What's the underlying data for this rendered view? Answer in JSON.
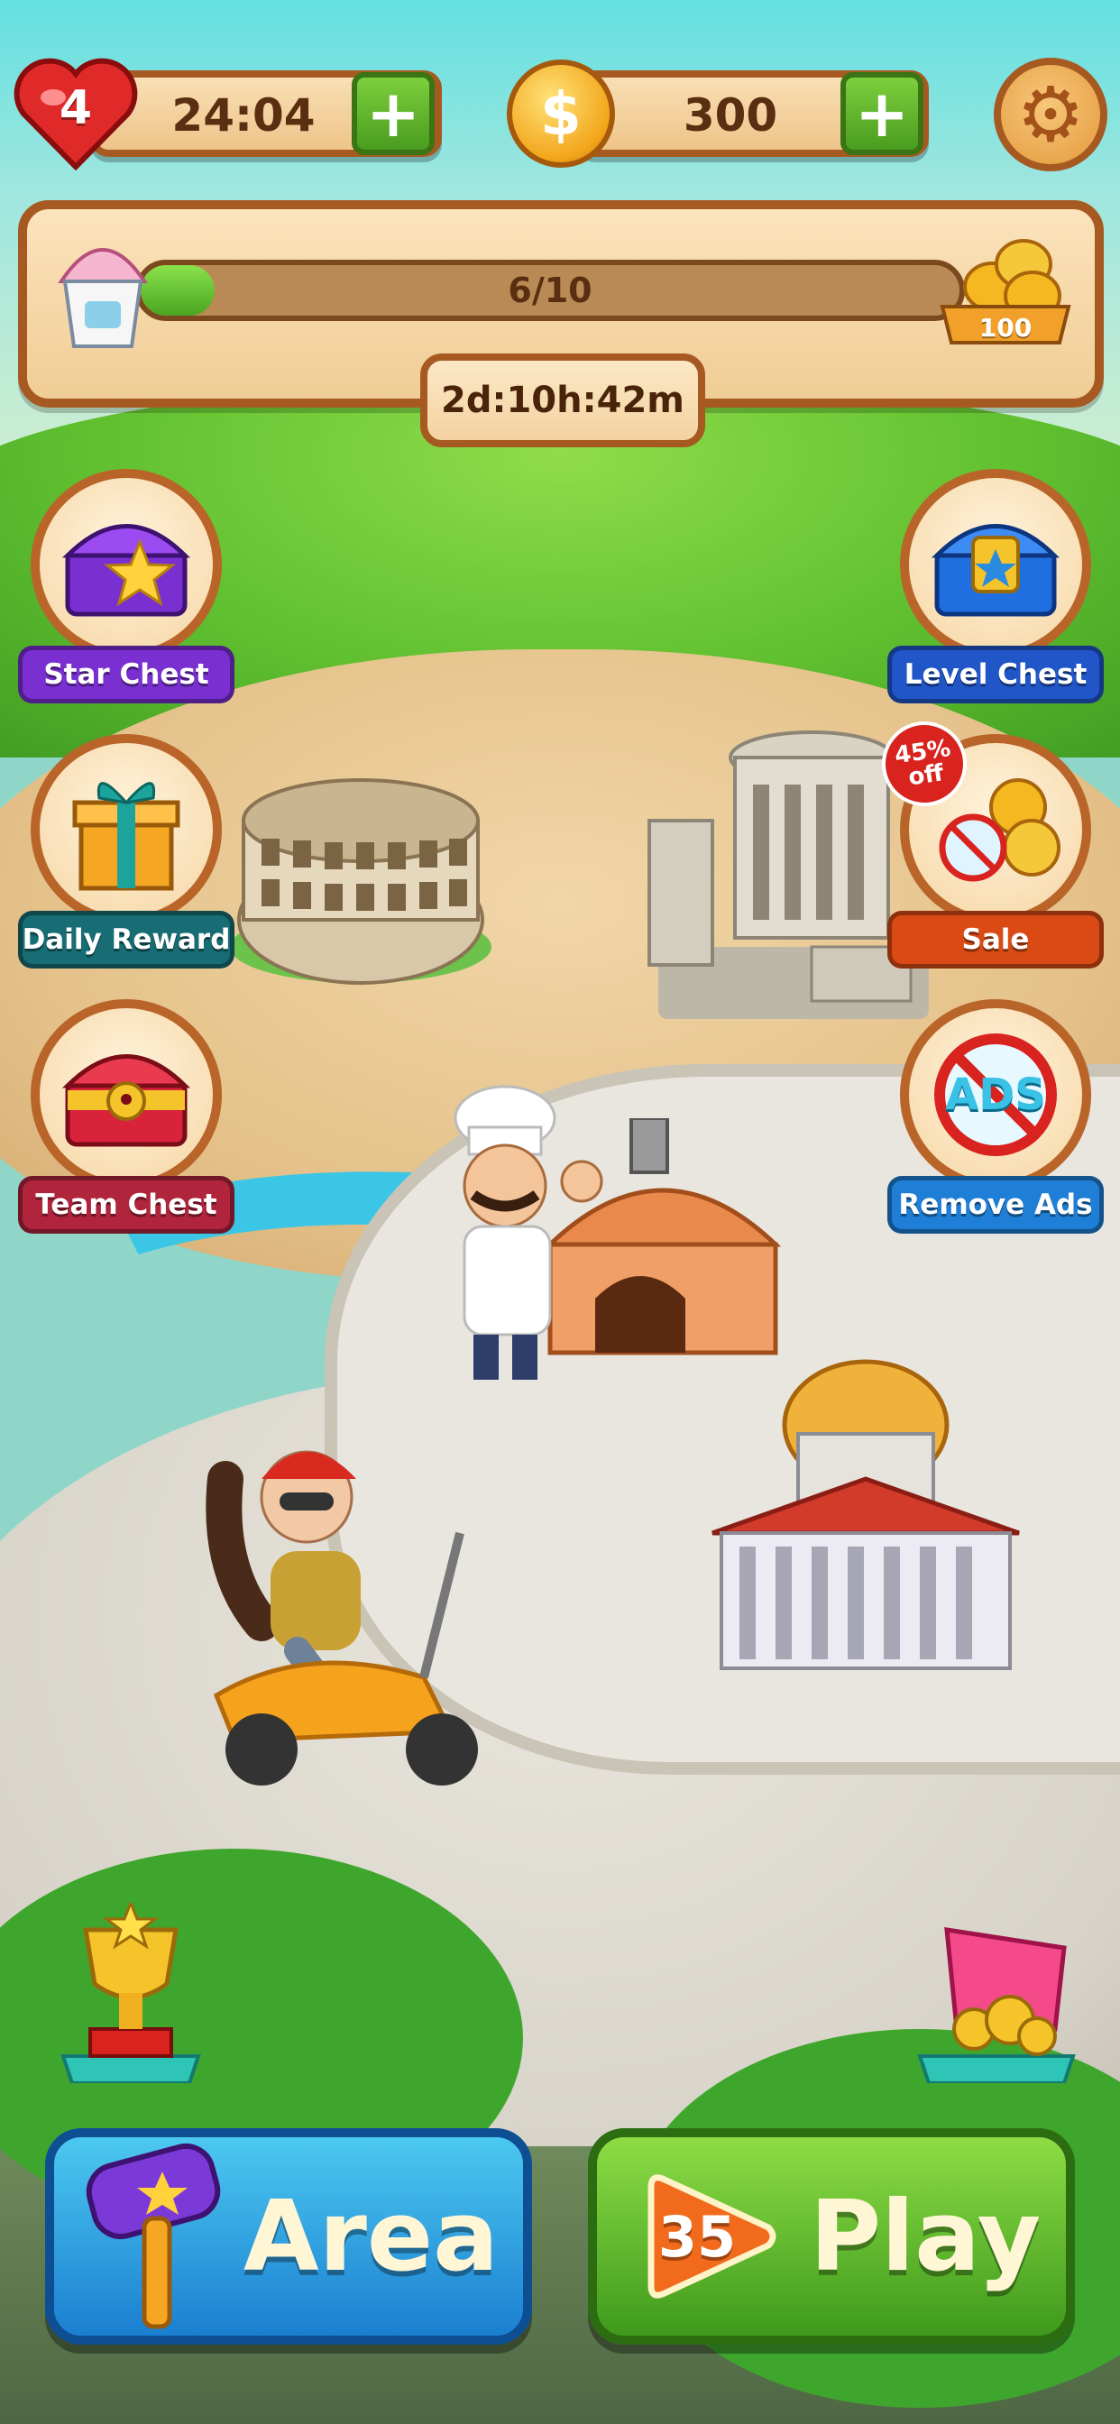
{
  "top_bar": {
    "lives": {
      "count": "4",
      "timer": "24:04",
      "add_icon": "plus-icon"
    },
    "coins": {
      "amount": "300",
      "icon": "dollar-coin-icon",
      "add_icon": "plus-icon"
    },
    "settings_icon": "gear-icon"
  },
  "event_panel": {
    "progress_label": "6/10",
    "progress_fraction": 0.6,
    "reward_amount": "100",
    "time_left": "2d:10h:42m"
  },
  "side_buttons": {
    "star_chest": {
      "label": "Star Chest",
      "color": "#7a2fd1"
    },
    "daily_reward": {
      "label": "Daily Reward",
      "color": "#176d73"
    },
    "team_chest": {
      "label": "Team Chest",
      "color": "#b0243c"
    },
    "level_chest": {
      "label": "Level Chest",
      "color": "#2156c9"
    },
    "sale": {
      "label": "Sale",
      "color": "#d94a14",
      "badge_percent": "45%",
      "badge_text": "off"
    },
    "remove_ads": {
      "label": "Remove Ads",
      "color": "#1f7fd6",
      "icon_text": "ADS"
    }
  },
  "bottom": {
    "area_label": "Area",
    "play_label": "Play",
    "play_level": "35"
  },
  "colors": {
    "wood_border": "#a65a22",
    "area_blue": "#1b7fd1",
    "play_green": "#3f9a1c"
  }
}
